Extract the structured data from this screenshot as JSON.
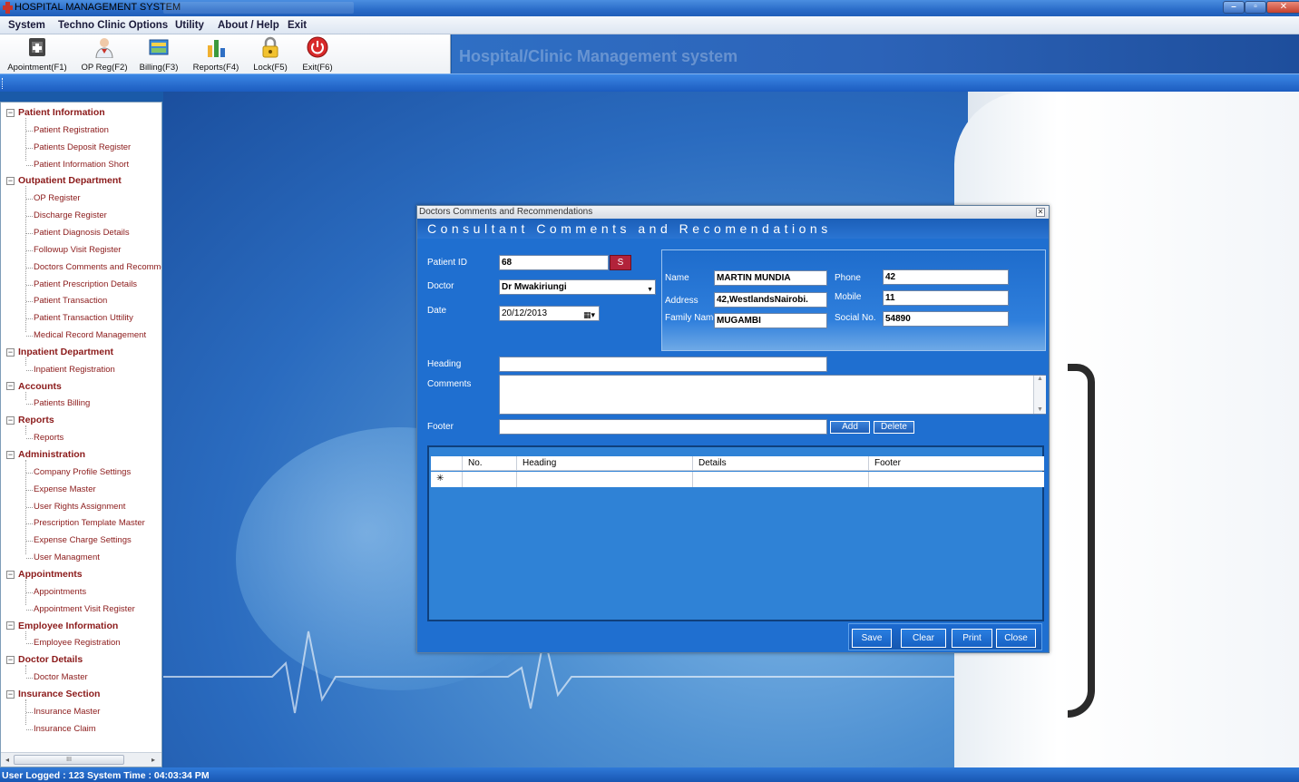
{
  "window": {
    "title": "HOSPITAL MANAGEMENT SYSTEM"
  },
  "menu": [
    "System",
    "Techno Clinic Options",
    "Utility",
    "About / Help",
    "Exit"
  ],
  "toolbar": [
    {
      "label": "Apointment(F1)",
      "icon": "appointment-icon"
    },
    {
      "label": "OP Reg(F2)",
      "icon": "op-registration-icon"
    },
    {
      "label": "Billing(F3)",
      "icon": "billing-icon"
    },
    {
      "label": "Reports(F4)",
      "icon": "reports-icon"
    },
    {
      "label": "Lock(F5)",
      "icon": "lock-icon"
    },
    {
      "label": "Exit(F6)",
      "icon": "exit-icon"
    }
  ],
  "banner": "Hospital/Clinic Management system",
  "sidebar": {
    "categories": [
      {
        "label": "Patient Information",
        "items": [
          "Patient Registration",
          "Patients Deposit Register",
          "Patient Information Short"
        ]
      },
      {
        "label": "Outpatient Department",
        "items": [
          "OP Register",
          "Discharge Register",
          "Patient Diagnosis Details",
          "Followup Visit Register",
          "Doctors Comments and Recommer",
          "Patient Prescription Details",
          "Patient Transaction",
          "Patient Transaction Uttility",
          "Medical Record Management"
        ]
      },
      {
        "label": "Inpatient Department",
        "items": [
          "Inpatient Registration"
        ]
      },
      {
        "label": "Accounts",
        "items": [
          "Patients Billing"
        ]
      },
      {
        "label": "Reports",
        "items": [
          "Reports"
        ]
      },
      {
        "label": "Administration",
        "items": [
          "Company Profile Settings",
          "Expense Master",
          "User Rights Assignment",
          "Prescription Template Master",
          "Expense Charge Settings",
          "User Managment"
        ]
      },
      {
        "label": "Appointments",
        "items": [
          "Appointments",
          "Appointment Visit Register"
        ]
      },
      {
        "label": "Employee Information",
        "items": [
          "Employee Registration"
        ]
      },
      {
        "label": "Doctor Details",
        "items": [
          "Doctor Master"
        ]
      },
      {
        "label": "Insurance Section",
        "items": [
          "Insurance Master",
          "Insurance Claim"
        ]
      }
    ],
    "scroll_thumb": "III"
  },
  "dialog": {
    "title": "Doctors Comments and Recommendations",
    "header": "Consultant Comments and Recomendations",
    "labels": {
      "patient_id": "Patient ID",
      "doctor": "Doctor",
      "date": "Date",
      "heading": "Heading",
      "comments": "Comments",
      "footer": "Footer",
      "name": "Name",
      "address": "Address",
      "family_name": "Family Name",
      "phone": "Phone",
      "mobile": "Mobile",
      "social_no": "Social No."
    },
    "values": {
      "patient_id": "68",
      "doctor": "Dr Mwakiriungi",
      "date": "20/12/2013",
      "heading": "",
      "comments": "",
      "footer": "",
      "name": "MARTIN MUNDIA",
      "address": "42,WestlandsNairobi.",
      "family_name": "MUGAMBI",
      "phone": "42",
      "mobile": "11",
      "social_no": "54890"
    },
    "search_button": "S",
    "add_button": "Add",
    "delete_button": "Delete",
    "grid": {
      "columns": [
        "No.",
        "Heading",
        "Details",
        "Footer"
      ],
      "new_row_marker": "✳"
    },
    "buttons": [
      "Save",
      "Clear",
      "Print",
      "Close"
    ]
  },
  "status": {
    "text": "User Logged : 123  System Time : 04:03:34 PM"
  },
  "colors": {
    "accent": "#1f6fd0",
    "tree_text": "#8b1a1a",
    "search_button": "#b2233a"
  }
}
